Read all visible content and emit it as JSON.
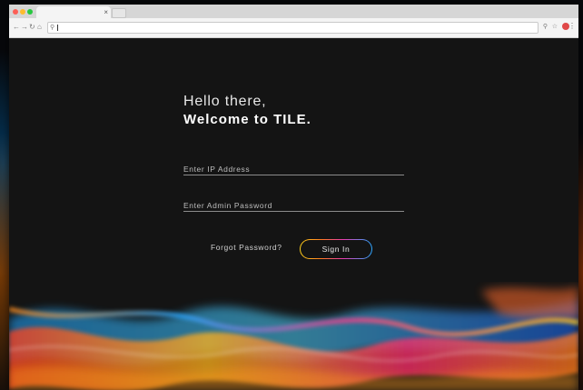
{
  "browser": {
    "tab_close": "×",
    "omnibox_value": "",
    "icons": {
      "back": "back-arrow-icon",
      "forward": "forward-arrow-icon",
      "reload": "reload-icon",
      "home": "home-icon",
      "search": "search-icon",
      "zoom": "zoom-icon",
      "bookmark": "star-icon",
      "extension": "extension-icon",
      "menu": "menu-dots-icon"
    }
  },
  "login": {
    "greeting": "Hello there,",
    "welcome": "Welcome to TILE.",
    "ip_placeholder": "Enter IP Address",
    "password_placeholder": "Enter Admin Password",
    "forgot_label": "Forgot Password?",
    "signin_label": "Sign In"
  },
  "colors": {
    "background": "#141414",
    "text": "#e8e8e8",
    "gradient_start": "#ffd21a",
    "gradient_mid": "#e83ab0",
    "gradient_end": "#2aa7ff"
  }
}
